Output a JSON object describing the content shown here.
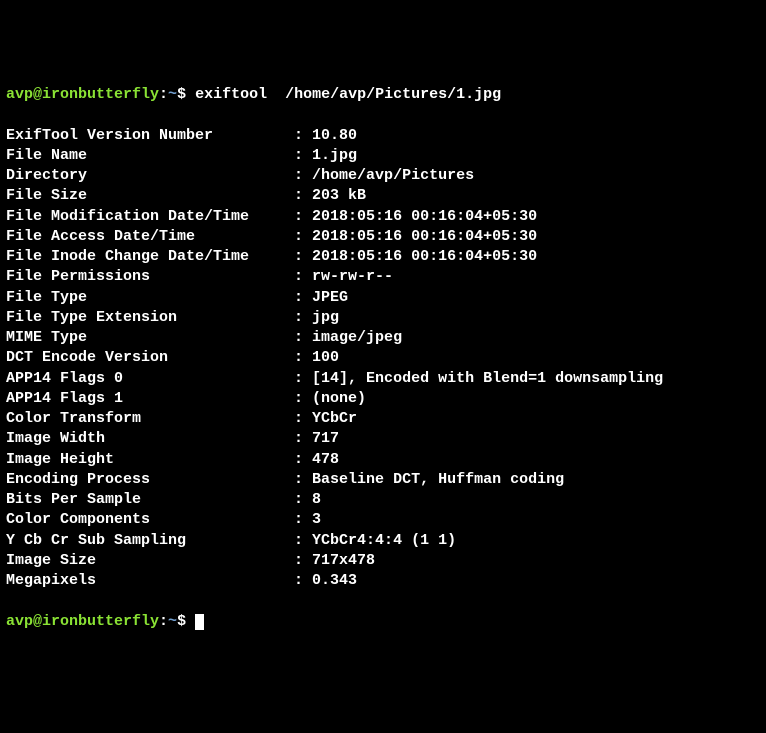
{
  "prompt": {
    "userhost": "avp@ironbutterfly",
    "colon": ":",
    "path": "~",
    "dollar": "$",
    "command": "exiftool  /home/avp/Pictures/1.jpg"
  },
  "rows": [
    {
      "label": "ExifTool Version Number",
      "value": "10.80"
    },
    {
      "label": "File Name",
      "value": "1.jpg"
    },
    {
      "label": "Directory",
      "value": "/home/avp/Pictures"
    },
    {
      "label": "File Size",
      "value": "203 kB"
    },
    {
      "label": "File Modification Date/Time",
      "value": "2018:05:16 00:16:04+05:30"
    },
    {
      "label": "File Access Date/Time",
      "value": "2018:05:16 00:16:04+05:30"
    },
    {
      "label": "File Inode Change Date/Time",
      "value": "2018:05:16 00:16:04+05:30"
    },
    {
      "label": "File Permissions",
      "value": "rw-rw-r--"
    },
    {
      "label": "File Type",
      "value": "JPEG"
    },
    {
      "label": "File Type Extension",
      "value": "jpg"
    },
    {
      "label": "MIME Type",
      "value": "image/jpeg"
    },
    {
      "label": "DCT Encode Version",
      "value": "100"
    },
    {
      "label": "APP14 Flags 0",
      "value": "[14], Encoded with Blend=1 downsampling"
    },
    {
      "label": "APP14 Flags 1",
      "value": "(none)"
    },
    {
      "label": "Color Transform",
      "value": "YCbCr"
    },
    {
      "label": "Image Width",
      "value": "717"
    },
    {
      "label": "Image Height",
      "value": "478"
    },
    {
      "label": "Encoding Process",
      "value": "Baseline DCT, Huffman coding"
    },
    {
      "label": "Bits Per Sample",
      "value": "8"
    },
    {
      "label": "Color Components",
      "value": "3"
    },
    {
      "label": "Y Cb Cr Sub Sampling",
      "value": "YCbCr4:4:4 (1 1)"
    },
    {
      "label": "Image Size",
      "value": "717x478"
    },
    {
      "label": "Megapixels",
      "value": "0.343"
    }
  ],
  "prompt2": {
    "userhost": "avp@ironbutterfly",
    "colon": ":",
    "path": "~",
    "dollar": "$",
    "after": " "
  }
}
